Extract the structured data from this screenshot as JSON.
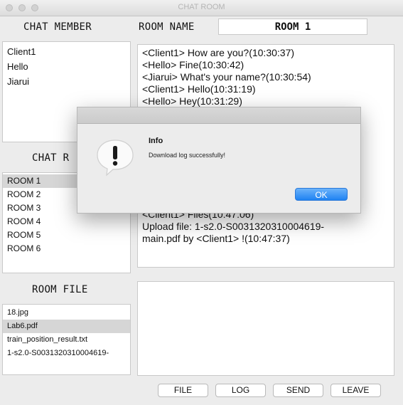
{
  "window": {
    "title": "CHAT ROOM"
  },
  "labels": {
    "chat_member": "CHAT MEMBER",
    "room_name": "ROOM NAME",
    "chat_room_partial": "CHAT R",
    "room_file": "ROOM FILE"
  },
  "room_name_value": "ROOM 1",
  "members": [
    "Client1",
    "Hello",
    "Jiarui"
  ],
  "rooms": [
    "ROOM 1",
    "ROOM 2",
    "ROOM 3",
    "ROOM 4",
    "ROOM 5",
    "ROOM 6"
  ],
  "files": [
    "18.jpg",
    "Lab6.pdf",
    "train_position_result.txt",
    "1-s2.0-S0031320310004619-"
  ],
  "messages_top": [
    "<Client1> How are you?(10:30:37)",
    "<Hello> Fine(10:30:42)",
    "<Jiarui> What's your name?(10:30:54)",
    "<Client1> Hello(10:31:19)",
    "<Hello> Hey(10:31:29)"
  ],
  "messages_bottom": [
    "<Client1> Files(10:47:06)",
    "Upload file: 1-s2.0-S0031320310004619-",
    "main.pdf by <Client1> !(10:47:37)"
  ],
  "buttons": {
    "file": "FILE",
    "log": "LOG",
    "send": "SEND",
    "leave": "LEAVE"
  },
  "dialog": {
    "title": "Info",
    "message": "Download log successfully!",
    "ok": "OK",
    "icon": "exclamation-icon"
  }
}
